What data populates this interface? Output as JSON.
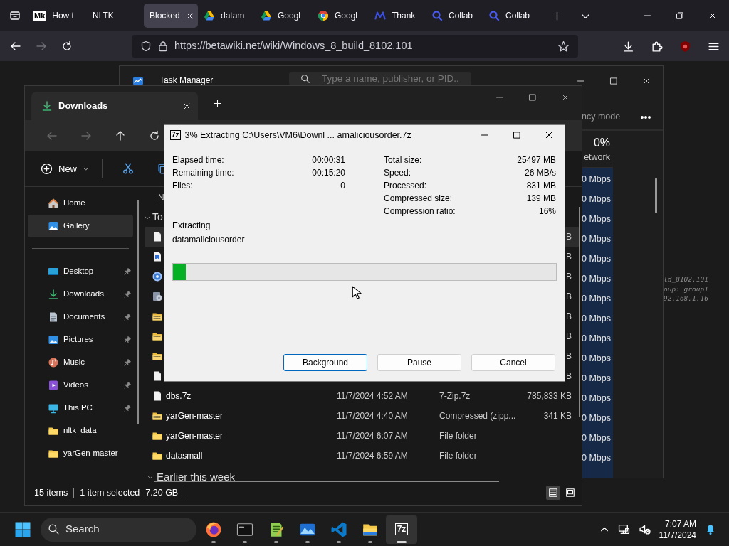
{
  "browser": {
    "tabs": [
      {
        "label": "How t",
        "kind": "mk",
        "favicon_text": "Mk",
        "selected": false
      },
      {
        "label": "NLTK",
        "kind": "none",
        "selected": false
      },
      {
        "label": "Blocked",
        "kind": "none",
        "selected": true
      },
      {
        "label": "datam",
        "kind": "drive",
        "selected": false
      },
      {
        "label": "Googl",
        "kind": "drive",
        "selected": false
      },
      {
        "label": "Googl",
        "kind": "chrome",
        "selected": false
      },
      {
        "label": "Thank",
        "kind": "m",
        "selected": false
      },
      {
        "label": "Collab",
        "kind": "collab",
        "selected": false
      },
      {
        "label": "Collab",
        "kind": "collab",
        "selected": false
      }
    ],
    "address": "https://betawiki.net/wiki/Windows_8_build_8102.101",
    "page_text": [
      "ld_8102.101",
      "oup: group1",
      "92.168.1.16"
    ]
  },
  "task_manager": {
    "title": "Task Manager",
    "search": {
      "placeholder": "Type a name, publisher, or PID..."
    },
    "mode_label": "ncy mode",
    "network_percent": "0%",
    "network_heading": "etwork",
    "network_rows": [
      "0 Mbps",
      "0 Mbps",
      "0 Mbps",
      "0 Mbps",
      "0 Mbps",
      "0 Mbps",
      "0 Mbps",
      "0 Mbps",
      "0 Mbps",
      "0 Mbps",
      "0 Mbps",
      "0 Mbps",
      "0 Mbps",
      "0 Mbps",
      "0 Mbps"
    ]
  },
  "explorer": {
    "tab": "Downloads",
    "nav": [
      {
        "kind": "back",
        "disabled": true
      },
      {
        "kind": "forward",
        "disabled": true
      },
      {
        "kind": "up",
        "disabled": false
      },
      {
        "kind": "refresh",
        "disabled": false
      }
    ],
    "new_label": "New",
    "sidebar": [
      {
        "kind": "home",
        "label": "Home",
        "selected": false,
        "pinned": false
      },
      {
        "kind": "gallery",
        "label": "Gallery",
        "selected": true,
        "pinned": false
      },
      {
        "kind": "divider"
      },
      {
        "kind": "desktop",
        "label": "Desktop",
        "selected": false,
        "pinned": true
      },
      {
        "kind": "downloads",
        "label": "Downloads",
        "selected": false,
        "pinned": true
      },
      {
        "kind": "documents",
        "label": "Documents",
        "selected": false,
        "pinned": true
      },
      {
        "kind": "pictures",
        "label": "Pictures",
        "selected": false,
        "pinned": true
      },
      {
        "kind": "music",
        "label": "Music",
        "selected": false,
        "pinned": true
      },
      {
        "kind": "videos",
        "label": "Videos",
        "selected": false,
        "pinned": true
      },
      {
        "kind": "pc",
        "label": "This PC",
        "selected": false,
        "pinned": true
      },
      {
        "kind": "folder",
        "label": "nltk_data",
        "selected": false,
        "pinned": false
      },
      {
        "kind": "folder",
        "label": "yarGen-master",
        "selected": false,
        "pinned": false
      }
    ],
    "column_header": "N",
    "group": "To",
    "rows": [
      {
        "kind": "file",
        "selected": true,
        "size": "B"
      },
      {
        "kind": "doc",
        "selected": false,
        "size": "B"
      },
      {
        "kind": "gear",
        "selected": false,
        "size": "B"
      },
      {
        "kind": "installer",
        "selected": false,
        "size": "B"
      },
      {
        "kind": "zip",
        "selected": false,
        "size": "B"
      },
      {
        "kind": "zip",
        "selected": false,
        "size": "B"
      },
      {
        "kind": "zip",
        "selected": false,
        "size": "B"
      },
      {
        "kind": "file",
        "selected": false,
        "size": "B"
      },
      {
        "kind": "file",
        "name": "dbs.7z",
        "date": "11/7/2024 4:52 AM",
        "type": "7-Zip.7z",
        "size": "785,833 KB",
        "selected": false
      },
      {
        "kind": "zip",
        "name": "yarGen-master",
        "date": "11/7/2024 4:40 AM",
        "type": "Compressed (zipp...",
        "size": "341 KB",
        "selected": false
      },
      {
        "kind": "folder",
        "name": "yarGen-master",
        "date": "11/7/2024 6:07 AM",
        "type": "File folder",
        "selected": false
      },
      {
        "kind": "folder",
        "name": "datasmall",
        "date": "11/7/2024 6:59 AM",
        "type": "File folder",
        "selected": false
      }
    ],
    "group2": "Earlier this week",
    "status": {
      "count": "15 items",
      "selection": "1 item selected",
      "size": "7.20 GB"
    },
    "views": [
      {
        "kind": "details",
        "selected": true
      },
      {
        "kind": "tiles",
        "selected": false
      }
    ]
  },
  "dialog": {
    "icon_text": "7z",
    "title": "3% Extracting C:\\Users\\VM6\\Downl ... amaliciousorder.7z",
    "stats_left": [
      {
        "label": "Elapsed time:",
        "value": "00:00:31"
      },
      {
        "label": "Remaining time:",
        "value": "00:15:20"
      },
      {
        "label": "Files:",
        "value": "0"
      }
    ],
    "stats_right": [
      {
        "label": "Total size:",
        "value": "25497 MB"
      },
      {
        "label": "Speed:",
        "value": "26 MB/s"
      },
      {
        "label": "Processed:",
        "value": "831 MB"
      },
      {
        "label": "Compressed size:",
        "value": "139 MB"
      },
      {
        "label": "Compression ratio:",
        "value": "16%"
      }
    ],
    "action": "Extracting",
    "current_file": "datamaliciousorder",
    "progress": {
      "level": 0.034
    },
    "buttons": [
      {
        "label": "Background",
        "focused": true
      },
      {
        "label": "Pause",
        "focused": false
      },
      {
        "label": "Cancel",
        "focused": false
      }
    ]
  },
  "taskbar": {
    "search": "Search",
    "apps": [
      {
        "kind": "firefox",
        "active": false
      },
      {
        "kind": "terminal",
        "active": false
      },
      {
        "kind": "notepad",
        "active": false
      },
      {
        "kind": "photos",
        "active": false
      },
      {
        "kind": "vscode",
        "active": false
      },
      {
        "kind": "explorer",
        "active": false
      },
      {
        "kind": "sevenzip",
        "label": "7z",
        "active": true
      }
    ],
    "time": "7:07 AM",
    "date": "11/7/2024"
  }
}
